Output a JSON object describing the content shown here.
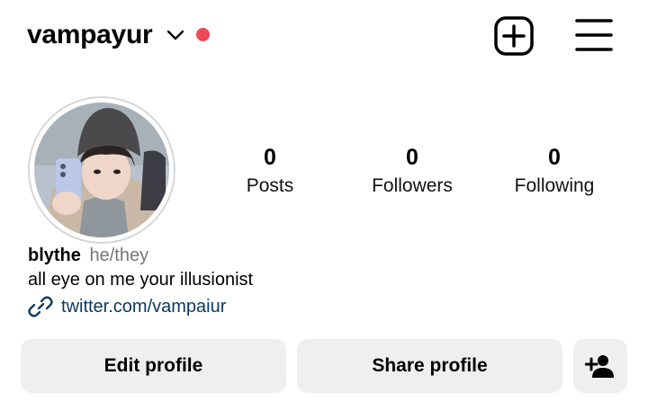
{
  "header": {
    "username": "vampayur",
    "icons": {
      "dropdown": "chevron-down-icon",
      "new_post": "plus-square-icon",
      "menu": "hamburger-menu-icon"
    },
    "notification_dot_color": "#ed4956"
  },
  "stats": [
    {
      "value": "0",
      "label": "Posts"
    },
    {
      "value": "0",
      "label": "Followers"
    },
    {
      "value": "0",
      "label": "Following"
    }
  ],
  "profile": {
    "name": "blythe",
    "pronouns": "he/they",
    "bio": "all eye on me your illusionist",
    "link": "twitter.com/vampaiur",
    "link_color": "#0c3a60"
  },
  "buttons": {
    "edit": "Edit profile",
    "share": "Share profile",
    "add_person_icon": "person-add-icon"
  }
}
